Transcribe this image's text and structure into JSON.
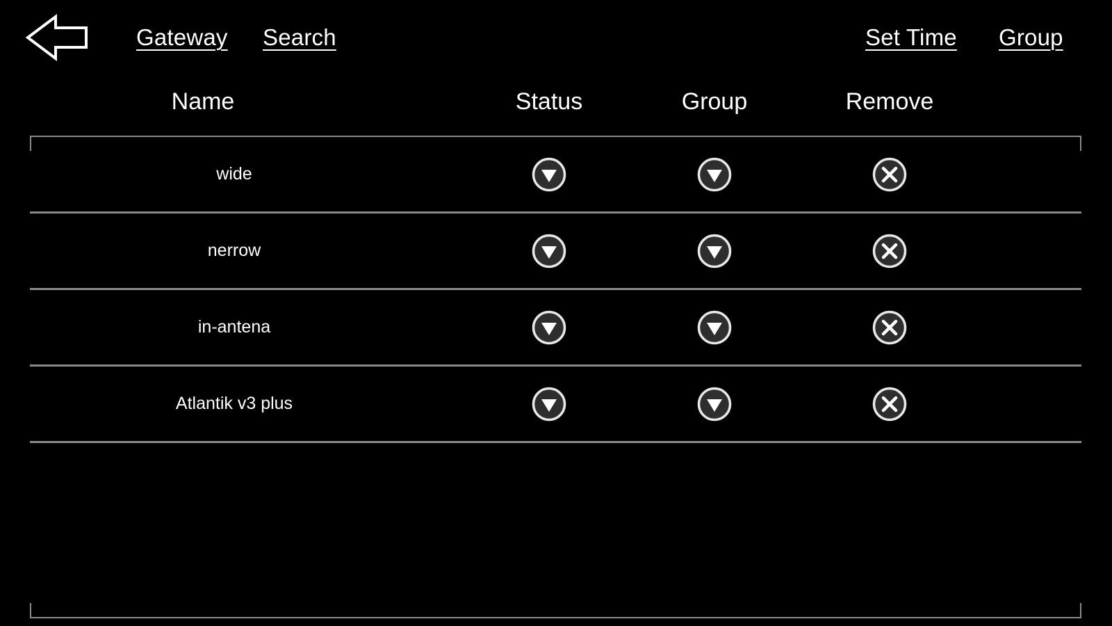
{
  "theme": {
    "background": "#000000",
    "text": "#ffffff",
    "rule": "#8a8a8a",
    "icon_ring": "#e8e8e8",
    "icon_fill": "#2e2e2e",
    "icon_glyph": "#ffffff"
  },
  "topbar": {
    "back_icon": "back-arrow-icon",
    "links": [
      {
        "label": "Gateway",
        "name": "gateway-link"
      },
      {
        "label": "Search",
        "name": "search-link"
      },
      {
        "label": "Set Time",
        "name": "set-time-link"
      },
      {
        "label": "Group",
        "name": "group-link"
      }
    ]
  },
  "table": {
    "headers": {
      "name": "Name",
      "status": "Status",
      "group": "Group",
      "remove": "Remove"
    },
    "row_icons": {
      "status": "chevron-down-circle-icon",
      "group": "chevron-down-circle-icon",
      "remove": "close-circle-icon"
    },
    "rows": [
      {
        "name": "wide"
      },
      {
        "name": "nerrow"
      },
      {
        "name": "in-antena"
      },
      {
        "name": "Atlantik v3 plus"
      }
    ]
  }
}
